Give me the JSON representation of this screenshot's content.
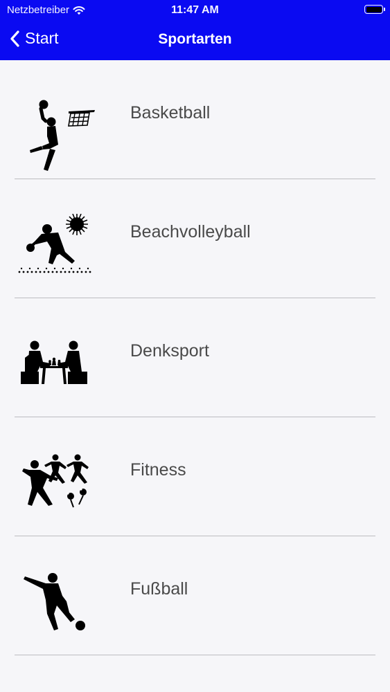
{
  "status_bar": {
    "carrier": "Netzbetreiber",
    "time": "11:47 AM",
    "wifi_icon": "wifi-icon",
    "battery_icon": "battery-icon"
  },
  "nav": {
    "back_label": "Start",
    "back_icon": "chevron-left-icon",
    "title": "Sportarten",
    "color": "#0a0af2"
  },
  "sports": [
    {
      "label": "Basketball",
      "icon": "basketball-pictogram-icon"
    },
    {
      "label": "Beachvolleyball",
      "icon": "beachvolleyball-pictogram-icon"
    },
    {
      "label": "Denksport",
      "icon": "chess-pictogram-icon"
    },
    {
      "label": "Fitness",
      "icon": "fitness-pictogram-icon"
    },
    {
      "label": "Fußball",
      "icon": "football-pictogram-icon"
    }
  ]
}
